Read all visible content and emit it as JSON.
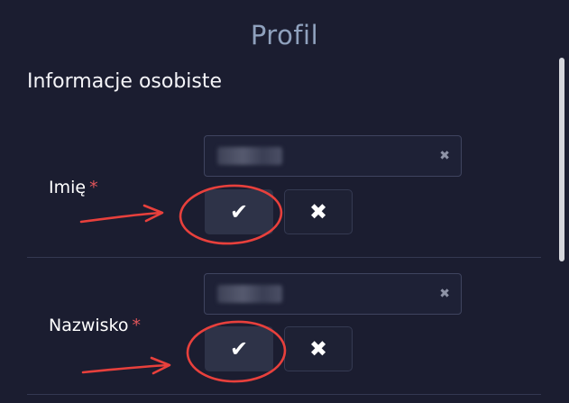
{
  "header": {
    "title": "Profil"
  },
  "section": {
    "title": "Informacje osobiste"
  },
  "fields": [
    {
      "label": "Imię",
      "required_mark": "*",
      "value": "•••••",
      "clear_icon": "✖",
      "confirm_icon": "✔",
      "cancel_icon": "✖"
    },
    {
      "label": "Nazwisko",
      "required_mark": "*",
      "value": "•••••",
      "clear_icon": "✖",
      "confirm_icon": "✔",
      "cancel_icon": "✖"
    }
  ],
  "colors": {
    "background": "#1b1d30",
    "title": "#8fa1bd",
    "required": "#e0555a",
    "annotation": "#e8403c"
  },
  "icons": [
    "check-icon",
    "close-icon",
    "clear-input-icon"
  ]
}
